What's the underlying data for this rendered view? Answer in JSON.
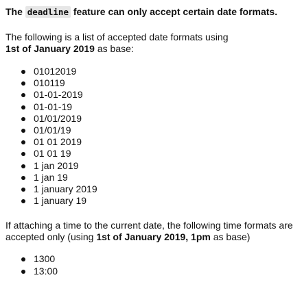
{
  "heading": {
    "prefix": "The",
    "code": "deadline",
    "suffix": "feature can only accept certain date formats."
  },
  "intro": {
    "text_before": "The following is a list of accepted date formats using",
    "bold": "1st of January 2019",
    "text_after": "as base:"
  },
  "date_formats": [
    "01012019",
    "010119",
    "01-01-2019",
    "01-01-19",
    "01/01/2019",
    "01/01/19",
    "01 01 2019",
    "01 01 19",
    "1 jan 2019",
    "1 jan 19",
    "1 january 2019",
    "1 january 19"
  ],
  "time_intro": {
    "text_before": "If attaching a time to the current date, the following time formats are accepted only (using",
    "bold": "1st of January 2019, 1pm",
    "text_after": "as base)"
  },
  "time_formats": [
    "1300",
    "13:00"
  ],
  "colors": {
    "text": "#111111",
    "code_background": "#e6e6e6",
    "background": "#ffffff"
  }
}
